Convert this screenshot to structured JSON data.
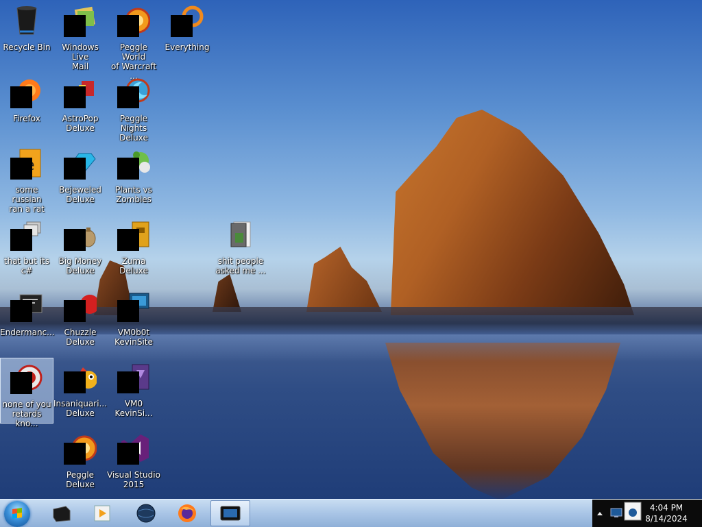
{
  "desktop": {
    "icons": [
      {
        "label": "Recycle Bin",
        "icon": "recycle-bin-icon",
        "selected": false
      },
      {
        "label": "Windows Live\nMail",
        "icon": "windows-live-mail-icon",
        "selected": false
      },
      {
        "label": "Peggle World\nof Warcraft ...",
        "icon": "peggle-world-of-warcraft-icon",
        "selected": false
      },
      {
        "label": "Everything",
        "icon": "everything-search-icon",
        "selected": false
      },
      {
        "label": "Firefox",
        "icon": "firefox-icon",
        "selected": false
      },
      {
        "label": "AstroPop\nDeluxe",
        "icon": "astropop-deluxe-icon",
        "selected": false
      },
      {
        "label": "Peggle Nights\nDeluxe",
        "icon": "peggle-nights-deluxe-icon",
        "selected": false
      },
      {
        "label": "some russian\nran a rat",
        "icon": "vlc-like-file-icon",
        "selected": false
      },
      {
        "label": "Bejeweled\nDeluxe",
        "icon": "bejeweled-deluxe-icon",
        "selected": false
      },
      {
        "label": "Plants vs\nZombies",
        "icon": "plants-vs-zombies-icon",
        "selected": false
      },
      {
        "label": "that but its c#",
        "icon": "stacked-windows-icon",
        "selected": false
      },
      {
        "label": "Big Money\nDeluxe",
        "icon": "big-money-deluxe-icon",
        "selected": false
      },
      {
        "label": "Zuma Deluxe",
        "icon": "zuma-deluxe-icon",
        "selected": false
      },
      {
        "label": "shit people\nasked me ...",
        "icon": "folder-icon",
        "selected": false
      },
      {
        "label": "Endermanc...",
        "icon": "terminal-window-icon",
        "selected": false
      },
      {
        "label": "Chuzzle\nDeluxe",
        "icon": "chuzzle-deluxe-icon",
        "selected": false
      },
      {
        "label": "VM0b0t\nKevinSite",
        "icon": "vm-site-icon",
        "selected": false
      },
      {
        "label": "none of you\nretards kno...",
        "icon": "sword-shield-icon",
        "selected": true
      },
      {
        "label": "Insaniquari...\nDeluxe",
        "icon": "insaniquarium-deluxe-icon",
        "selected": false
      },
      {
        "label": "VM0\nKevinSi...",
        "icon": "vm-kevin-site-icon",
        "selected": false
      },
      {
        "label": "Peggle Deluxe",
        "icon": "peggle-deluxe-icon",
        "selected": false
      },
      {
        "label": "Visual Studio\n2015",
        "icon": "visual-studio-icon",
        "selected": false
      }
    ]
  },
  "taskbar": {
    "start_icon": "windows-start-orb-icon",
    "pinned": [
      {
        "icon": "black-box-app-icon",
        "active": false
      },
      {
        "icon": "media-player-icon",
        "active": false
      },
      {
        "icon": "dark-globe-icon",
        "active": false
      },
      {
        "icon": "firefox-icon",
        "active": false
      },
      {
        "icon": "monitor-window-icon",
        "active": true
      }
    ],
    "tray": {
      "icons": [
        "show-hidden-icons-chevron-icon",
        "network-monitor-icon",
        "notification-app-icon"
      ],
      "time": "4:04 PM",
      "date": "8/14/2024"
    }
  },
  "colors": {
    "taskbar_top": "#c9ddf2",
    "taskbar_bottom": "#8fb0d8",
    "tray_bg": "#0b0b0b",
    "icon_mask": "#000000",
    "selection": "#c8dcf5"
  }
}
